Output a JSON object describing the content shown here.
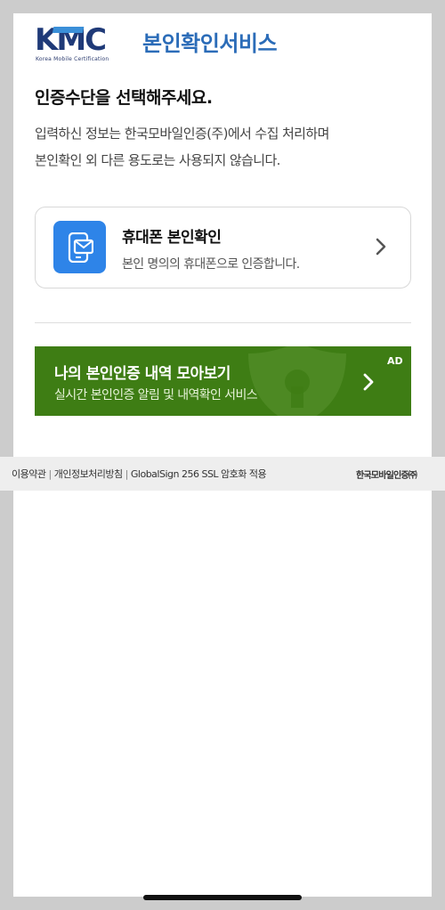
{
  "header": {
    "logo_text": "KMC",
    "logo_subtext": "Korea Mobile Certification",
    "title": "본인확인서비스"
  },
  "intro": {
    "heading": "인증수단을 선택해주세요.",
    "description_line1": "입력하신 정보는 한국모바일인증(주)에서 수집 처리하며",
    "description_line2": "본인확인 외 다른 용도로는 사용되지 않습니다."
  },
  "method": {
    "icon": "phone-message-icon",
    "title": "휴대폰 본인확인",
    "subtitle": "본인 명의의 휴대폰으로 인증합니다."
  },
  "ad": {
    "title": "나의 본인인증 내역 모아보기",
    "subtitle": "실시간 본인인증 알림 및 내역확인 서비스",
    "badge": "AD"
  },
  "footer": {
    "terms": "이용약관",
    "privacy": "개인정보처리방침",
    "ssl": "GlobalSign 256 SSL 암호화 적용",
    "brand": "한국모바일인증㈜"
  },
  "colors": {
    "brand_blue": "#2b6cb8",
    "icon_blue": "#2e84e8",
    "ad_green": "#3e7d14",
    "background_gray": "#cccccc"
  }
}
